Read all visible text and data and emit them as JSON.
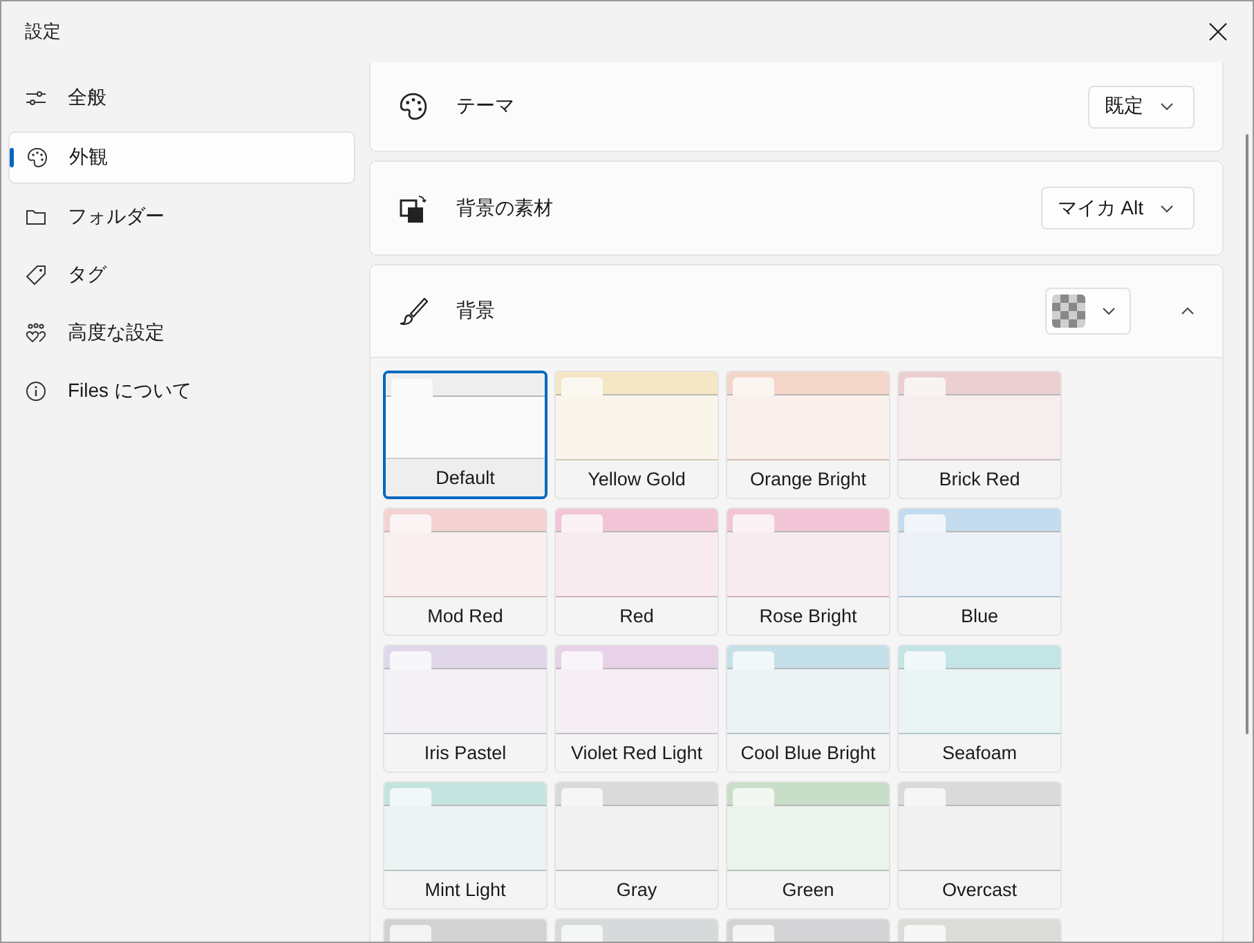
{
  "window": {
    "title": "設定"
  },
  "sidebar": {
    "items": [
      {
        "label": "全般",
        "selected": false
      },
      {
        "label": "外観",
        "selected": true
      },
      {
        "label": "フォルダー",
        "selected": false
      },
      {
        "label": "タグ",
        "selected": false
      },
      {
        "label": "高度な設定",
        "selected": false
      },
      {
        "label": "Files について",
        "selected": false
      }
    ]
  },
  "settings": [
    {
      "kind": "dropdown",
      "label": "テーマ",
      "value": "既定"
    },
    {
      "kind": "dropdown",
      "label": "背景の素材",
      "value": "マイカ Alt"
    },
    {
      "kind": "swatch",
      "label": "背景",
      "expanded": true
    }
  ],
  "backgrounds": [
    {
      "label": "Default",
      "color": "#eeeeee",
      "selected": true
    },
    {
      "label": "Yellow Gold",
      "color": "#f5e6c4",
      "selected": false
    },
    {
      "label": "Orange Bright",
      "color": "#f3d6c8",
      "selected": false
    },
    {
      "label": "Brick Red",
      "color": "#ebcfd1",
      "selected": false
    },
    {
      "label": "Mod Red",
      "color": "#f4d2d2",
      "selected": false
    },
    {
      "label": "Red",
      "color": "#f2c5d6",
      "selected": false
    },
    {
      "label": "Rose Bright",
      "color": "#f2c5d6",
      "selected": false
    },
    {
      "label": "Blue",
      "color": "#c5dbee",
      "selected": false
    },
    {
      "label": "Iris Pastel",
      "color": "#e0d8ea",
      "selected": false
    },
    {
      "label": "Violet Red Light",
      "color": "#e8d2e8",
      "selected": false
    },
    {
      "label": "Cool Blue Bright",
      "color": "#c4e0e8",
      "selected": false
    },
    {
      "label": "Seafoam",
      "color": "#c4e5e5",
      "selected": false
    },
    {
      "label": "Mint Light",
      "color": "#c4e5df",
      "selected": false
    },
    {
      "label": "Gray",
      "color": "#dadada",
      "selected": false
    },
    {
      "label": "Green",
      "color": "#c8dec8",
      "selected": false
    },
    {
      "label": "Overcast",
      "color": "#dadada",
      "selected": false
    },
    {
      "color": "#d2d2d2",
      "selected": false
    },
    {
      "color": "#d6dadb",
      "selected": false
    },
    {
      "color": "#d4d4d6",
      "selected": false
    },
    {
      "color": "#dcdcd8",
      "selected": false
    }
  ]
}
